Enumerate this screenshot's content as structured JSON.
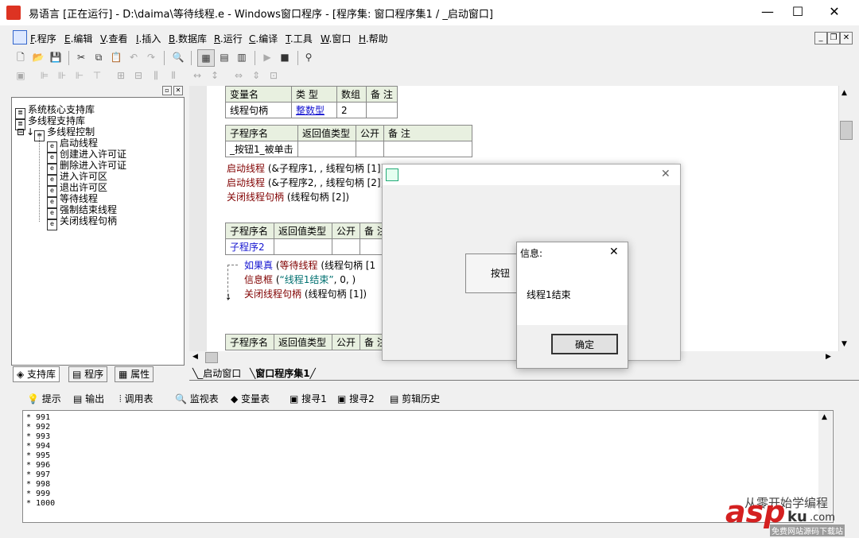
{
  "window": {
    "title": "易语言 [正在运行] - D:\\daima\\等待线程.e - Windows窗口程序 - [程序集: 窗口程序集1 / _启动窗口]",
    "minimize": "—",
    "maximize": "☐",
    "close": "✕"
  },
  "menu": [
    {
      "key": "F",
      "label": ".程序"
    },
    {
      "key": "E",
      "label": ".编辑"
    },
    {
      "key": "V",
      "label": ".查看"
    },
    {
      "key": "I",
      "label": ".插入"
    },
    {
      "key": "B",
      "label": ".数据库"
    },
    {
      "key": "R",
      "label": ".运行"
    },
    {
      "key": "C",
      "label": ".编译"
    },
    {
      "key": "T",
      "label": ".工具"
    },
    {
      "key": "W",
      "label": ".窗口"
    },
    {
      "key": "H",
      "label": ".帮助"
    }
  ],
  "tree": {
    "items": [
      "系统核心支持库",
      "多线程支持库",
      "多线程控制",
      "启动线程",
      "创建进入许可证",
      "删除进入许可证",
      "进入许可区",
      "退出许可区",
      "等待线程",
      "强制结束线程",
      "关闭线程句柄"
    ],
    "expander": "⊟"
  },
  "left_tabs": [
    "支持库",
    "程序",
    "属性"
  ],
  "var_table": {
    "headers": [
      "变量名",
      "类 型",
      "数组",
      "备 注"
    ],
    "row": [
      "线程句柄",
      "整数型",
      "2",
      ""
    ]
  },
  "sub1": {
    "headers": [
      "子程序名",
      "返回值类型",
      "公开",
      "备 注"
    ],
    "name": "_按钮1_被单击",
    "lines": [
      {
        "kw": "启动线程",
        "rest": " (&子程序1, , 线程句柄 [1])"
      },
      {
        "kw": "启动线程",
        "rest": " (&子程序2, , 线程句柄 [2])"
      },
      {
        "kw": "关闭线程句柄",
        "rest": " (线程句柄 [2])"
      }
    ]
  },
  "sub2": {
    "headers": [
      "子程序名",
      "返回值类型",
      "公开",
      "备 注"
    ],
    "name": "子程序2",
    "if_kw": "如果真",
    "if_rest_kw": "等待线程",
    "if_rest": " (线程句柄 [1",
    "msg_kw": "信息框",
    "msg_str": "“线程1结束”",
    "msg_rest": ", 0, )",
    "close_kw": "关闭线程句柄",
    "close_rest": " (线程句柄 [1])"
  },
  "sub3": {
    "headers": [
      "子程序名",
      "返回值类型",
      "公开",
      "备 注"
    ]
  },
  "doc_tabs": [
    "_启动窗口",
    "窗口程序集1"
  ],
  "out_tabs": [
    "提示",
    "输出",
    "调用表",
    "监视表",
    "变量表",
    "搜寻1",
    "搜寻2",
    "剪辑历史"
  ],
  "output_lines": [
    "* 991",
    "* 992",
    "* 993",
    "* 994",
    "* 995",
    "* 996",
    "* 997",
    "* 998",
    "* 999",
    "* 1000"
  ],
  "form_window": {
    "button": "按钮",
    "close": "✕"
  },
  "message_box": {
    "title": "信息:",
    "text": "线程1结束",
    "ok": "确定",
    "close": "✕"
  },
  "watermark": {
    "text1": "从零开始学编程",
    "logo": "asp",
    "logo2": "ku",
    "sub": "免费网站源码下载站",
    ".com": ".com"
  },
  "colors": {
    "keyword": "#800000",
    "type": "#1414d0",
    "string": "#007070",
    "header_bg": "#e8f0e0",
    "watermark": "#d42020"
  }
}
